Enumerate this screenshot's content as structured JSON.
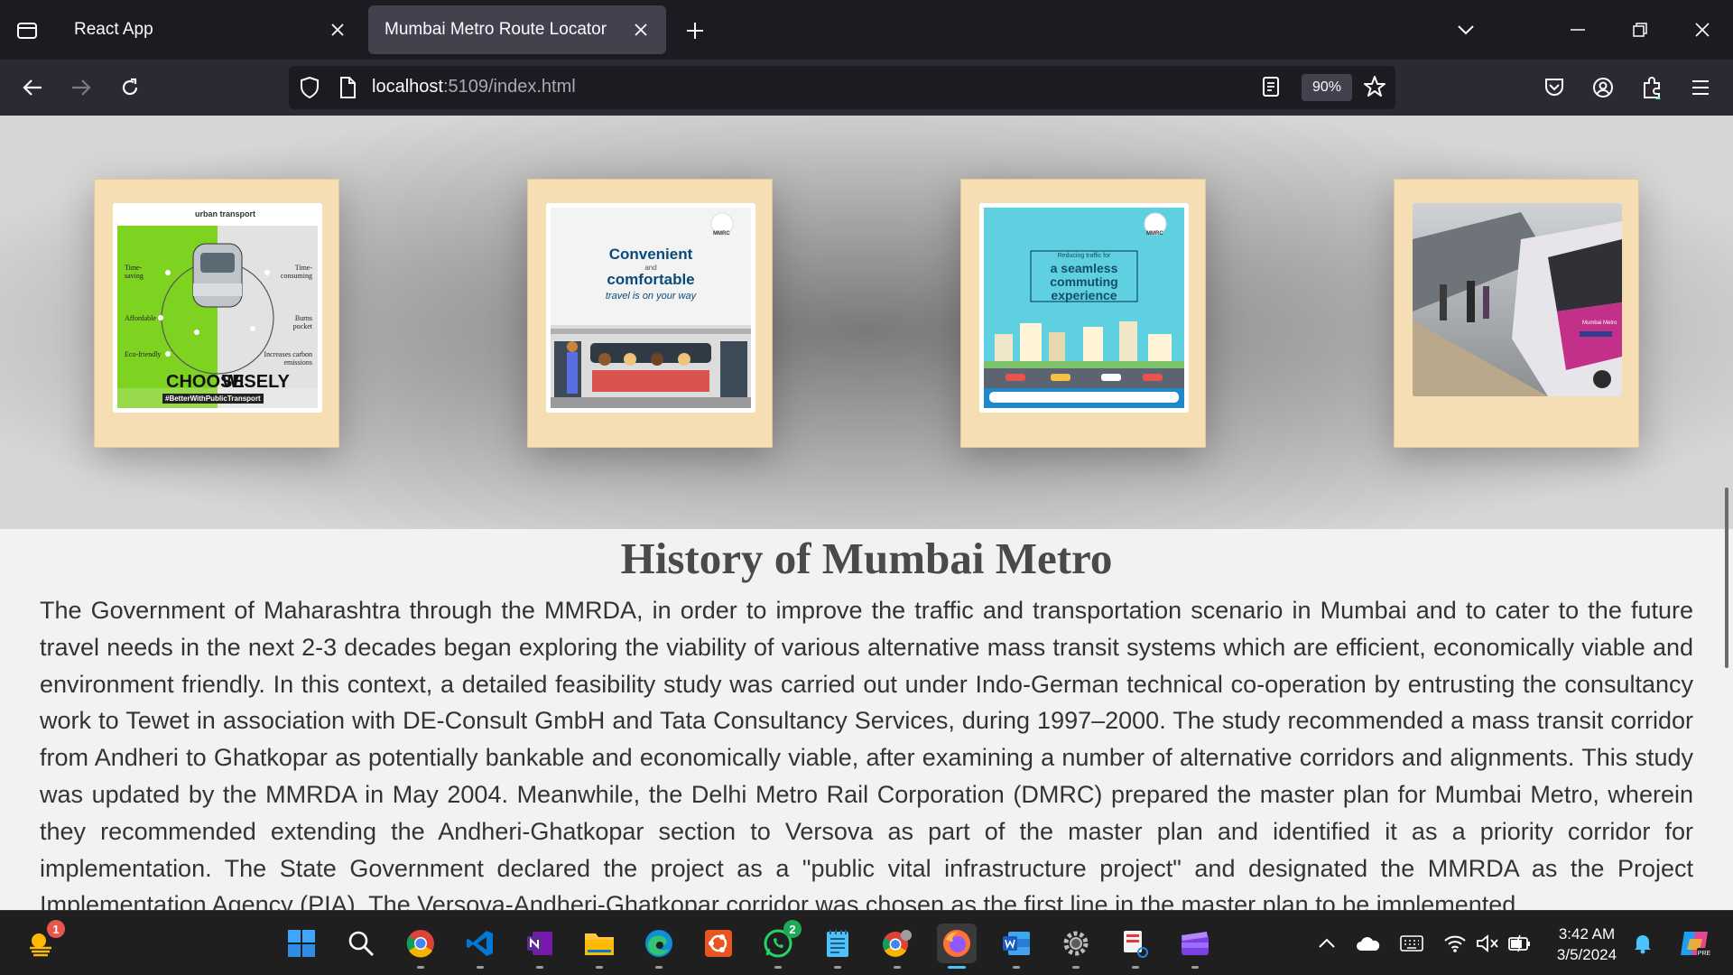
{
  "browser": {
    "tabs": [
      {
        "title": "React App",
        "active": false
      },
      {
        "title": "Mumbai Metro Route Locator",
        "active": true
      }
    ],
    "url_host": "localhost",
    "url_path": ":5109/index.html",
    "zoom": "90%"
  },
  "gallery": {
    "card1": {
      "header_logo": "urban transport",
      "labels_left": [
        "Time-saving",
        "Affordable",
        "Eco-friendly"
      ],
      "labels_right": [
        "Time-consuming",
        "Burns pocket",
        "Increases carbon emissions"
      ],
      "choose": "CHOOSE",
      "wisely": "WISELY",
      "hashtag": "#BetterWithPublicTransport"
    },
    "card2": {
      "badge": "MMRC",
      "line1": "Convenient",
      "line2": "and",
      "line3": "comfortable",
      "line4": "travel is on your way"
    },
    "card3": {
      "badge": "MMRC",
      "small": "Reducing traffic for",
      "line1": "a seamless",
      "line2": "commuting",
      "line3": "experience"
    },
    "card4": {
      "train_text": "Mumbai Metro"
    }
  },
  "history": {
    "title": "History of Mumbai Metro",
    "body": "The Government of Maharashtra through the MMRDA, in order to improve the traffic and transportation scenario in Mumbai and to cater to the future travel needs in the next 2-3 decades began exploring the viability of various alternative mass transit systems which are efficient, economically viable and environment friendly. In this context, a detailed feasibility study was carried out under Indo-German technical co-operation by entrusting the consultancy work to Tewet in association with DE-Consult GmbH and Tata Consultancy Services, during 1997–2000. The study recommended a mass transit corridor from Andheri to Ghatkopar as potentially bankable and economically viable, after examining a number of alternative corridors and alignments. This study was updated by the MMRDA in May 2004. Meanwhile, the Delhi Metro Rail Corporation (DMRC) prepared the master plan for Mumbai Metro, wherein they recommended extending the Andheri-Ghatkopar section to Versova as part of the master plan and identified it as a priority corridor for implementation. The State Government declared the project as a \"public vital infrastructure project\" and designated the MMRDA as the Project Implementation Agency (PIA). The Versova-Andheri-Ghatkopar corridor was chosen as the first line in the master plan to be implemented."
  },
  "taskbar": {
    "weather_badge": "1",
    "whatsapp_badge": "2",
    "time": "3:42 AM",
    "date": "3/5/2024"
  },
  "colors": {
    "card_bg": "#f5deb3",
    "tab_active": "#42414d",
    "taskbar_accent": "#4cc2ff"
  }
}
